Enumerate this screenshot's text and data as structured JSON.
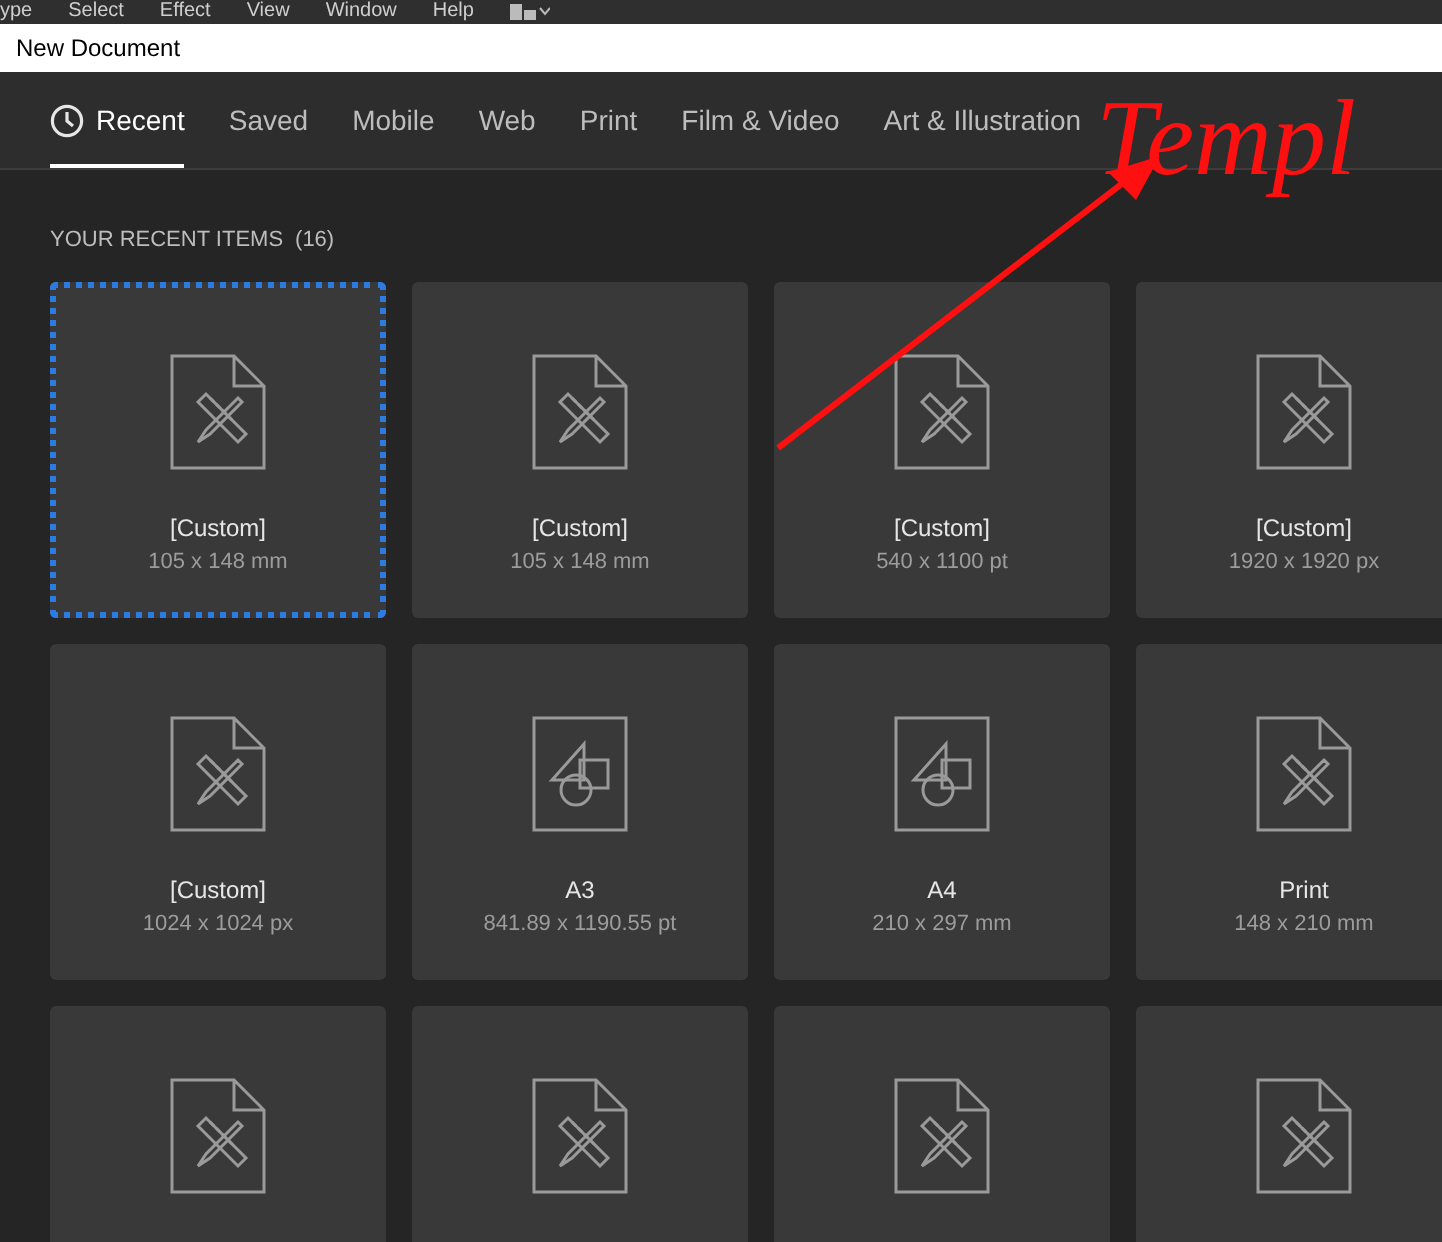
{
  "menu_bar": [
    "ype",
    "Select",
    "Effect",
    "View",
    "Window",
    "Help"
  ],
  "window": {
    "title": "New Document"
  },
  "tabs": [
    {
      "label": "Recent",
      "selected": true
    },
    {
      "label": "Saved",
      "selected": false
    },
    {
      "label": "Mobile",
      "selected": false
    },
    {
      "label": "Web",
      "selected": false
    },
    {
      "label": "Print",
      "selected": false
    },
    {
      "label": "Film & Video",
      "selected": false
    },
    {
      "label": "Art & Illustration",
      "selected": false
    }
  ],
  "section": {
    "title": "YOUR RECENT ITEMS",
    "count": "(16)"
  },
  "items": [
    {
      "kind": "sheet",
      "name": "[Custom]",
      "size": "105 x 148 mm",
      "selected": true
    },
    {
      "kind": "sheet",
      "name": "[Custom]",
      "size": "105 x 148 mm",
      "selected": false
    },
    {
      "kind": "sheet",
      "name": "[Custom]",
      "size": "540 x 1100 pt",
      "selected": false
    },
    {
      "kind": "sheet",
      "name": "[Custom]",
      "size": "1920 x 1920 px",
      "selected": false
    },
    {
      "kind": "sheet",
      "name": "[Custom]",
      "size": "1024 x 1024 px",
      "selected": false
    },
    {
      "kind": "shapes",
      "name": "A3",
      "size": "841.89 x 1190.55 pt",
      "selected": false
    },
    {
      "kind": "shapes",
      "name": "A4",
      "size": "210 x 297 mm",
      "selected": false
    },
    {
      "kind": "sheet",
      "name": "Print",
      "size": "148 x 210 mm",
      "selected": false
    },
    {
      "kind": "sheet",
      "selected": false
    },
    {
      "kind": "sheet",
      "selected": false
    },
    {
      "kind": "sheet",
      "selected": false
    },
    {
      "kind": "sheet",
      "selected": false
    }
  ],
  "annotation": {
    "text": "Templ"
  }
}
